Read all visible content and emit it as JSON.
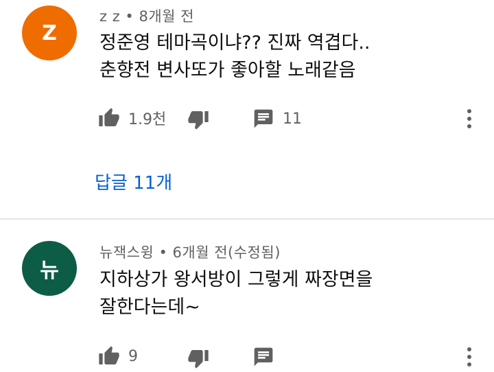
{
  "colors": {
    "avatar_1": "#ef6c00",
    "avatar_2": "#0d5c46",
    "link": "#065fd4",
    "secondary_text": "#606060"
  },
  "comments": [
    {
      "avatar_letter": "Z",
      "author": "z z",
      "separator": "•",
      "time": "8개월 전",
      "text_lines": [
        "정준영 테마곡이냐?? 진짜 역겹다..",
        "춘향전 변사또가 좋아할 노래같음"
      ],
      "likes": "1.9천",
      "reply_count": "11",
      "replies_link": "답글 11개",
      "icons": [
        "thumbs-up-icon",
        "thumbs-down-icon",
        "reply-icon",
        "more-vert-icon"
      ]
    },
    {
      "avatar_letter": "뉴",
      "author": "뉴잭스윙",
      "separator": "•",
      "time": "6개월 전(수정됨)",
      "text_lines": [
        "지하상가 왕서방이 그렇게 짜장면을",
        "잘한다는데~"
      ],
      "likes": "9",
      "icons": [
        "thumbs-up-icon",
        "thumbs-down-icon",
        "reply-icon",
        "more-vert-icon"
      ]
    }
  ]
}
